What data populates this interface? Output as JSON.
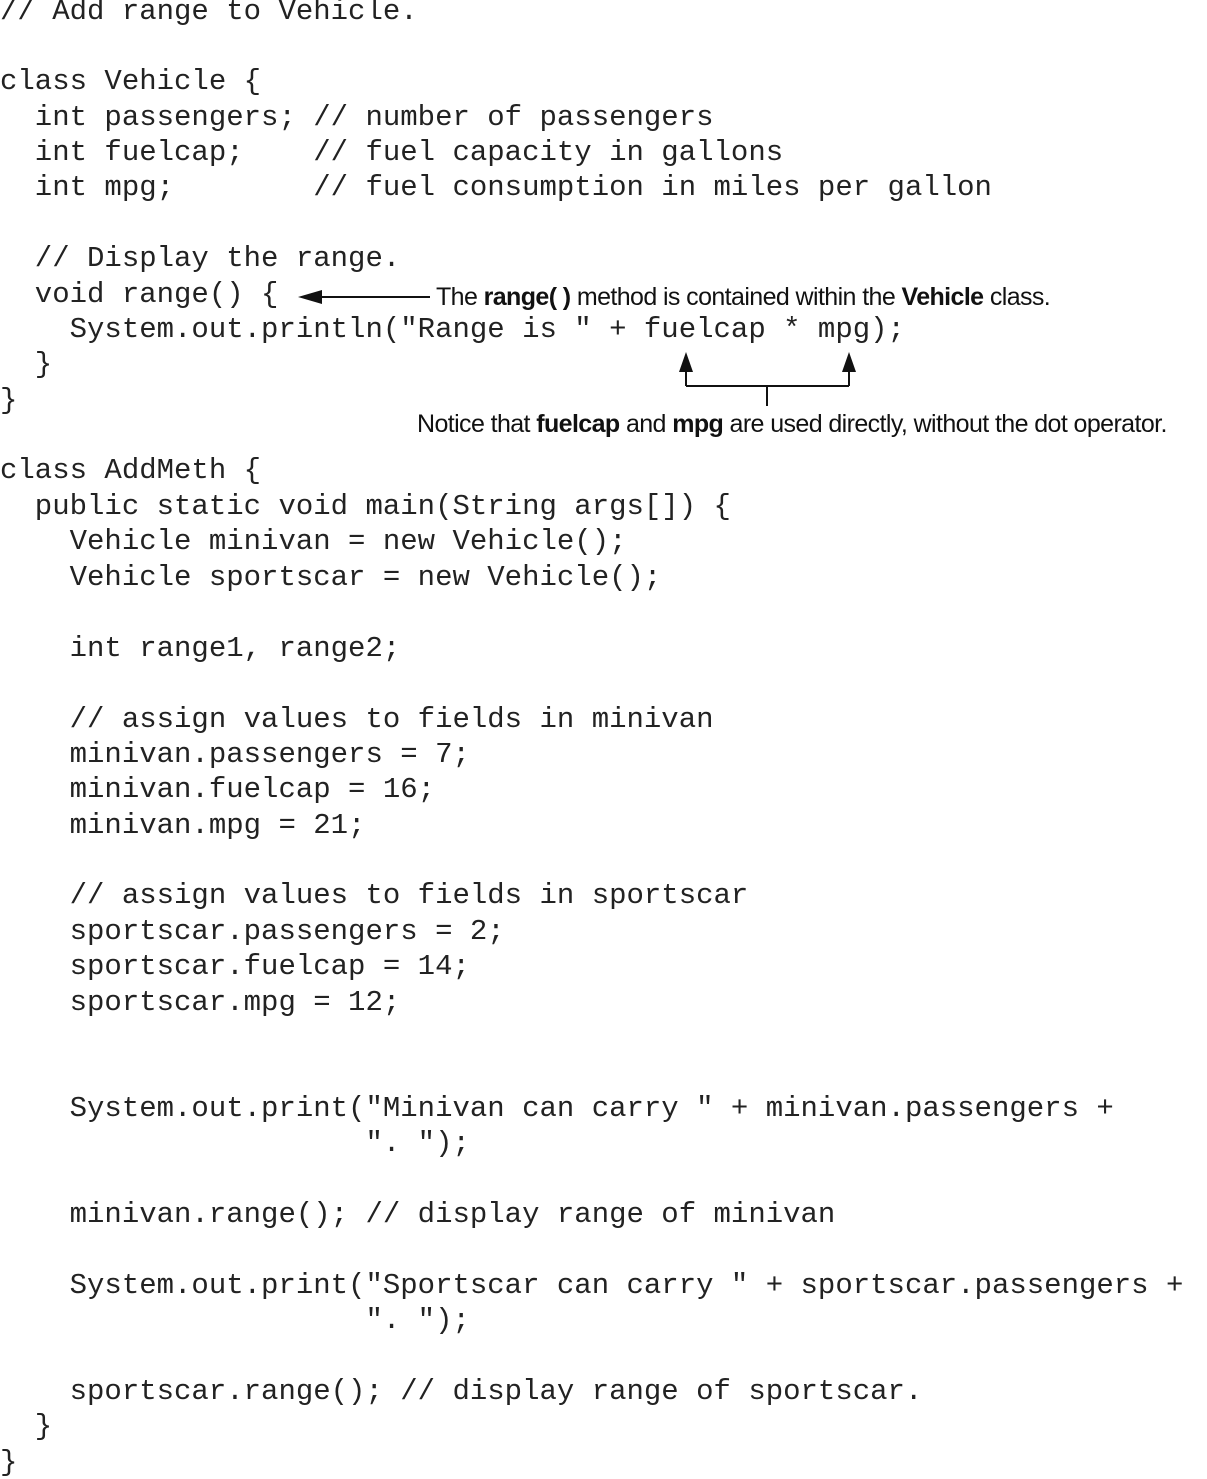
{
  "code_lines": [
    "// Add range to Vehicle.",
    "class Vehicle {",
    "  int passengers; // number of passengers",
    "  int fuelcap;    // fuel capacity in gallons",
    "  int mpg;        // fuel consumption in miles per gallon",
    "  // Display the range.",
    "  void range() {",
    "    System.out.println(\"Range is \" + fuelcap * mpg);",
    "  }",
    "}",
    "class AddMeth {",
    "  public static void main(String args[]) {",
    "    Vehicle minivan = new Vehicle();",
    "    Vehicle sportscar = new Vehicle();",
    "    int range1, range2;",
    "    // assign values to fields in minivan",
    "    minivan.passengers = 7;",
    "    minivan.fuelcap = 16;",
    "    minivan.mpg = 21;",
    "    // assign values to fields in sportscar",
    "    sportscar.passengers = 2;",
    "    sportscar.fuelcap = 14;",
    "    sportscar.mpg = 12;",
    "    System.out.print(\"Minivan can carry \" + minivan.passengers +",
    "                     \". \");",
    "    minivan.range(); // display range of minivan",
    "    System.out.print(\"Sportscar can carry \" + sportscar.passengers +",
    "                     \". \");",
    "    sportscar.range(); // display range of sportscar.",
    "  }",
    "}"
  ],
  "annotations": {
    "range_method": {
      "t1": "The ",
      "b1": "range( )",
      "t2": " method is contained within the ",
      "b2": "Vehicle",
      "t3": " class."
    },
    "direct_use": {
      "t1": "Notice that ",
      "b1": "fuelcap",
      "t2": " and ",
      "b2": "mpg",
      "t3": " are used directly, without the dot operator."
    }
  }
}
